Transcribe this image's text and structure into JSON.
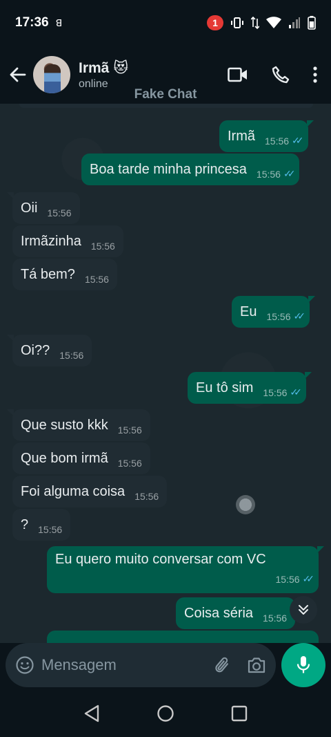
{
  "status_bar": {
    "time": "17:36",
    "notification_count": "1"
  },
  "header": {
    "contact_name": "Irmã 😻",
    "contact_status": "online"
  },
  "watermark": "Fake Chat",
  "messages": [
    {
      "dir": "out",
      "text": "Irmã",
      "time": "15:56"
    },
    {
      "dir": "out",
      "text": "Boa tarde minha princesa",
      "time": "15:56"
    },
    {
      "dir": "in",
      "text": "Oii",
      "time": "15:56"
    },
    {
      "dir": "in",
      "text": "Irmãzinha",
      "time": "15:56"
    },
    {
      "dir": "in",
      "text": "Tá bem?",
      "time": "15:56"
    },
    {
      "dir": "out",
      "text": "Eu",
      "time": "15:56"
    },
    {
      "dir": "in",
      "text": "Oi??",
      "time": "15:56"
    },
    {
      "dir": "out",
      "text": "Eu tô sim",
      "time": "15:56"
    },
    {
      "dir": "in",
      "text": "Que susto kkk",
      "time": "15:56"
    },
    {
      "dir": "in",
      "text": "Que bom irmã",
      "time": "15:56"
    },
    {
      "dir": "in",
      "text": "Foi alguma coisa",
      "time": "15:56"
    },
    {
      "dir": "in",
      "text": "?",
      "time": "15:56"
    },
    {
      "dir": "out",
      "text": "Eu quero muito conversar com VC",
      "time": "15:56"
    },
    {
      "dir": "out",
      "text": "Coisa séria",
      "time": "15:56"
    }
  ],
  "composer": {
    "placeholder": "Mensagem"
  },
  "colors": {
    "background": "#0b141a",
    "chat_bg": "#1c282e",
    "incoming_bubble": "#202c33",
    "outgoing_bubble": "#005c4b",
    "read_ticks": "#53bdeb",
    "accent": "#00a884"
  },
  "icons": {
    "back": "arrow-left-icon",
    "video": "video-camera-icon",
    "call": "phone-icon",
    "menu": "more-vertical-icon",
    "emoji": "emoji-icon",
    "attach": "paperclip-icon",
    "camera": "camera-icon",
    "mic": "microphone-icon",
    "scroll": "chevrons-down-icon"
  }
}
